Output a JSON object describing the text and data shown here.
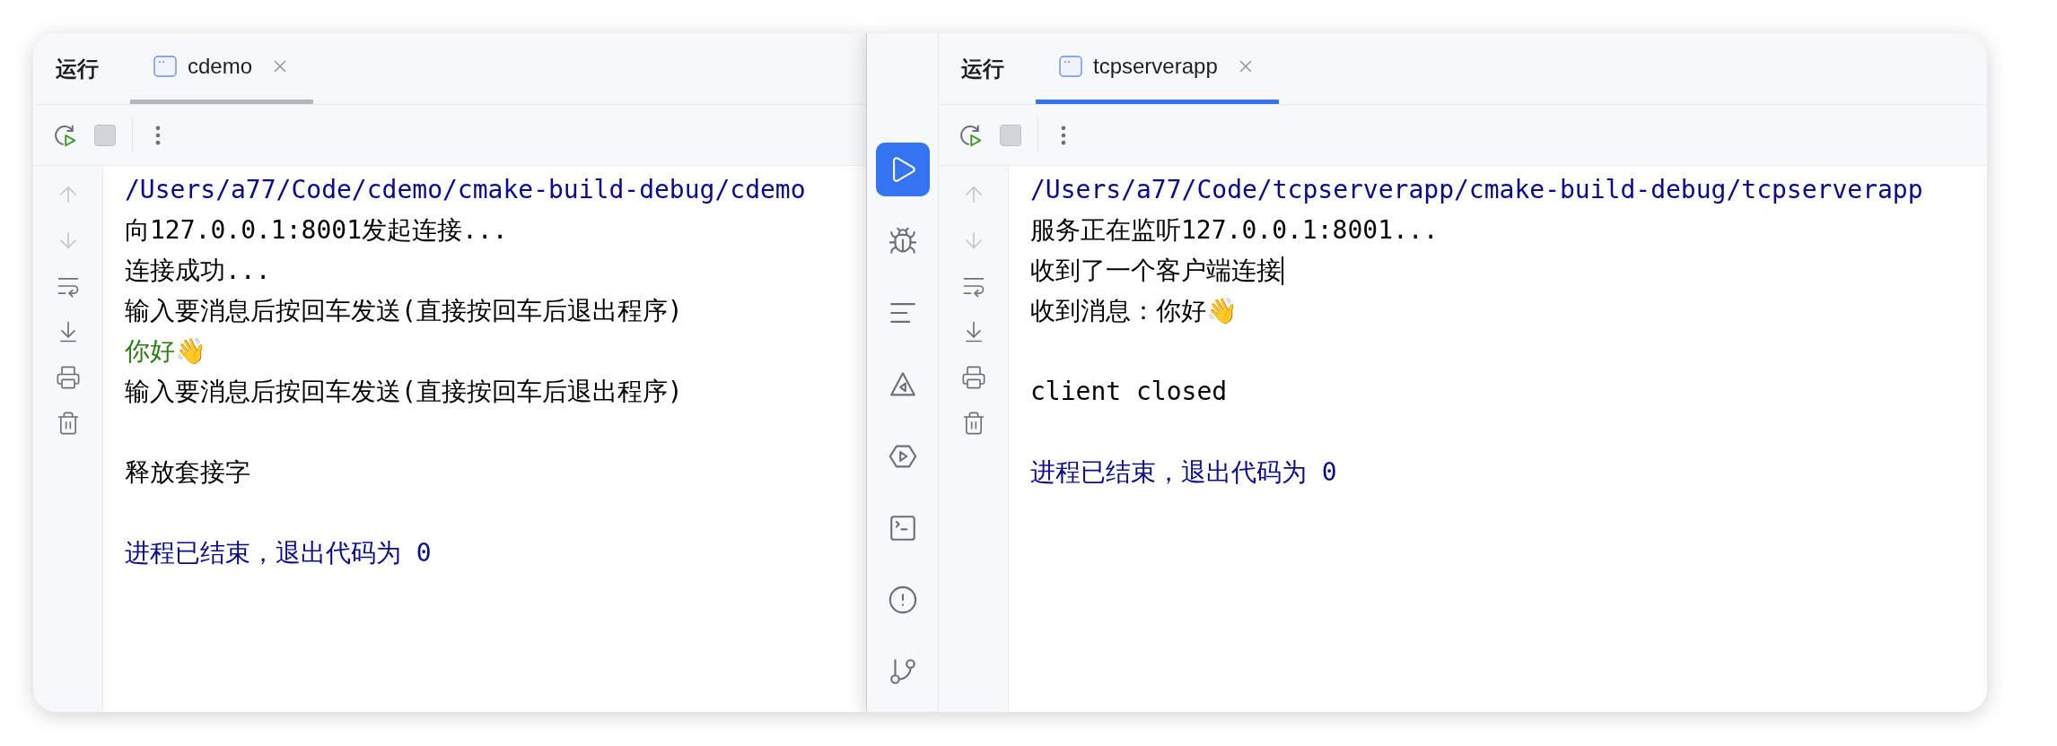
{
  "windows": [
    {
      "run_label": "运行",
      "tab": {
        "title": "cdemo",
        "selected": true,
        "focused": false
      },
      "console": [
        {
          "kind": "path",
          "text": "/Users/a77/Code/cdemo/cmake-build-debug/cdemo"
        },
        {
          "kind": "normal",
          "text": "向127.0.0.1:8001发起连接..."
        },
        {
          "kind": "normal",
          "text": "连接成功..."
        },
        {
          "kind": "normal",
          "text": "输入要消息后按回车发送(直接按回车后退出程序)"
        },
        {
          "kind": "input",
          "text": "你好👋"
        },
        {
          "kind": "normal",
          "text": "输入要消息后按回车发送(直接按回车后退出程序)"
        },
        {
          "kind": "blank"
        },
        {
          "kind": "normal",
          "text": "释放套接字"
        },
        {
          "kind": "blank"
        },
        {
          "kind": "exit",
          "text": "进程已结束，退出代码为 0"
        }
      ]
    },
    {
      "tool_strip": [
        {
          "kind": "run",
          "selected": true
        },
        {
          "kind": "debug",
          "selected": false
        },
        {
          "kind": "structure",
          "selected": false
        },
        {
          "kind": "build",
          "selected": false
        },
        {
          "kind": "services",
          "selected": false
        },
        {
          "kind": "terminal",
          "selected": false
        },
        {
          "kind": "problems",
          "selected": false
        },
        {
          "kind": "git",
          "selected": false
        }
      ],
      "run_label": "运行",
      "tab": {
        "title": "tcpserverapp",
        "selected": true,
        "focused": true
      },
      "console": [
        {
          "kind": "path",
          "text": "/Users/a77/Code/tcpserverapp/cmake-build-debug/tcpserverapp"
        },
        {
          "kind": "normal",
          "text": "服务正在监听127.0.0.1:8001..."
        },
        {
          "kind": "normal",
          "text": "收到了一个客户端连接",
          "cursor": true
        },
        {
          "kind": "normal",
          "text": "收到消息：你好👋"
        },
        {
          "kind": "blank"
        },
        {
          "kind": "normal",
          "text": "client closed"
        },
        {
          "kind": "blank"
        },
        {
          "kind": "exit",
          "text": "进程已结束，退出代码为 0"
        }
      ]
    }
  ]
}
